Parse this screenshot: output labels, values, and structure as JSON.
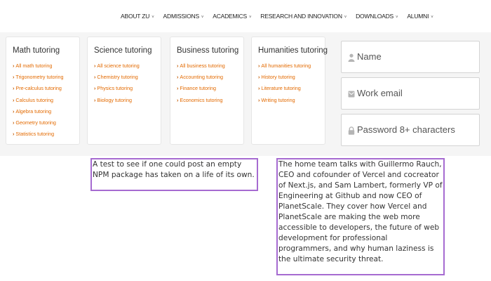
{
  "nav": {
    "items": [
      {
        "label": "ABOUT ZU",
        "caret": "˅"
      },
      {
        "label": "ADMISSIONS",
        "caret": "˅"
      },
      {
        "label": "ACADEMICS",
        "caret": "˅"
      },
      {
        "label": "RESEARCH AND INNOVATION",
        "caret": "˅"
      },
      {
        "label": "DOWNLOADS",
        "caret": "˅"
      },
      {
        "label": "ALUMNI",
        "caret": "˅"
      }
    ]
  },
  "menu": {
    "columns": [
      {
        "title": "Math tutoring",
        "links": [
          "All math tutoring",
          "Trigonometry tutoring",
          "Pre-calculus tutoring",
          "Calculus tutoring",
          "Algebra tutoring",
          "Geometry tutoring",
          "Statistics tutoring"
        ]
      },
      {
        "title": "Science tutoring",
        "links": [
          "All science tutoring",
          "Chemistry tutoring",
          "Physics tutoring",
          "Biology tutoring"
        ]
      },
      {
        "title": "Business tutoring",
        "links": [
          "All business tutoring",
          "Accounting tutoring",
          "Finance tutoring",
          "Economics tutoring"
        ]
      },
      {
        "title": "Humanities tutoring",
        "links": [
          "All humanities tutoring",
          "History tutoring",
          "Literature tutoring",
          "Writing tutoring"
        ]
      }
    ],
    "link_chevron": "›"
  },
  "form": {
    "name_placeholder": "Name",
    "email_placeholder": "Work email",
    "password_placeholder": "Password 8+ characters"
  },
  "articles": {
    "first": "A test to see if one could post an empty NPM package has taken on a life of its own.",
    "second": "The home team talks with Guillermo Rauch, CEO and cofounder of Vercel and cocreator of Next.js, and Sam Lambert, formerly VP of Engineering at Github and now CEO of PlanetScale. They cover how Vercel and PlanetScale are making the web more accessible to developers, the future of web development for professional programmers, and why human laziness is the ultimate security threat."
  },
  "colors": {
    "accent_link": "#e36a00",
    "box_border": "#a66bd1",
    "icon_gray": "#b5b5b5"
  }
}
